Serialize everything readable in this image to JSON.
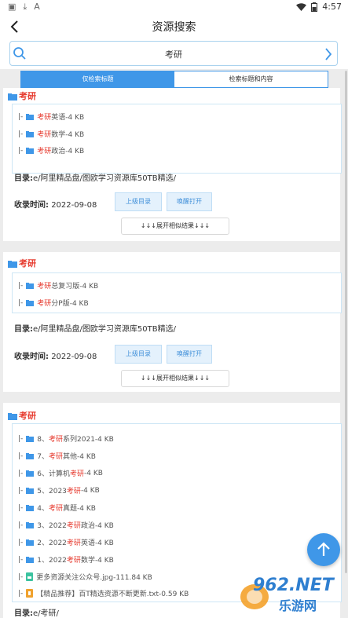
{
  "status": {
    "time": "4:57",
    "icons": [
      "gallery-icon",
      "download-icon",
      "font-icon",
      "wifi-icon",
      "battery-icon"
    ]
  },
  "header": {
    "title": "资源搜索"
  },
  "search": {
    "query": "考研"
  },
  "tabs": [
    {
      "label": "仅检索标题",
      "active": true
    },
    {
      "label": "检索标题和内容",
      "active": false
    }
  ],
  "results": [
    {
      "title": "考研",
      "files": [
        {
          "bar": "|-",
          "type": "folder",
          "highlight": "考研",
          "rest": "英语-4 KB"
        },
        {
          "bar": "|-",
          "type": "folder",
          "highlight": "考研",
          "rest": "数学-4 KB"
        },
        {
          "bar": "|-",
          "type": "folder",
          "highlight": "考研",
          "rest": "政治-4 KB"
        }
      ],
      "dir_label": "目录:",
      "dir_value": "e/阿里精品盘/图欧学习资源库50TB精选/",
      "time_label": "收录时间:",
      "time_value": "2022-09-08",
      "btn_parent": "上级目录",
      "btn_open": "唤醒打开",
      "expand": "↓↓↓展开相似结果↓↓↓"
    },
    {
      "title": "考研",
      "files": [
        {
          "bar": "|-",
          "type": "folder",
          "highlight": "考研",
          "rest": "总复习版-4 KB"
        },
        {
          "bar": "|-",
          "type": "folder",
          "highlight": "考研",
          "rest": "分P版-4 KB"
        }
      ],
      "dir_label": "目录:",
      "dir_value": "e/阿里精品盘/图欧学习资源库50TB精选/",
      "time_label": "收录时间:",
      "time_value": "2022-09-08",
      "btn_parent": "上级目录",
      "btn_open": "唤醒打开",
      "expand": "↓↓↓展开相似结果↓↓↓"
    },
    {
      "title": "考研",
      "files": [
        {
          "bar": "|-",
          "type": "folder",
          "pre": "8、",
          "highlight": "考研",
          "rest": "系列2021-4 KB"
        },
        {
          "bar": "|-",
          "type": "folder",
          "pre": "7、",
          "highlight": "考研",
          "rest": "其他-4 KB"
        },
        {
          "bar": "|-",
          "type": "folder",
          "pre": "6、计算机",
          "highlight": "考研",
          "rest": "-4 KB"
        },
        {
          "bar": "|-",
          "type": "folder",
          "pre": "5、2023",
          "highlight": "考研",
          "rest": "-4 KB"
        },
        {
          "bar": "|-",
          "type": "folder",
          "pre": "4、",
          "highlight": "考研",
          "rest": "真题-4 KB"
        },
        {
          "bar": "|-",
          "type": "folder",
          "pre": "3、2022",
          "highlight": "考研",
          "rest": "政治-4 KB"
        },
        {
          "bar": "|-",
          "type": "folder",
          "pre": "2、2022",
          "highlight": "考研",
          "rest": "英语-4 KB"
        },
        {
          "bar": "|-",
          "type": "folder",
          "pre": "1、2022",
          "highlight": "考研",
          "rest": "数学-4 KB"
        },
        {
          "bar": "|-",
          "type": "image",
          "pre": "更多资源关注公众号.jpg-111.84 KB",
          "highlight": "",
          "rest": ""
        },
        {
          "bar": "|-",
          "type": "text",
          "pre": "【精品推荐】百T精选资源不断更新.txt-0.59 KB",
          "highlight": "",
          "rest": ""
        }
      ],
      "dir_label": "目录:",
      "dir_value": "e/考研/"
    }
  ],
  "watermark": {
    "text": "962.NET",
    "sub": "乐游网"
  }
}
